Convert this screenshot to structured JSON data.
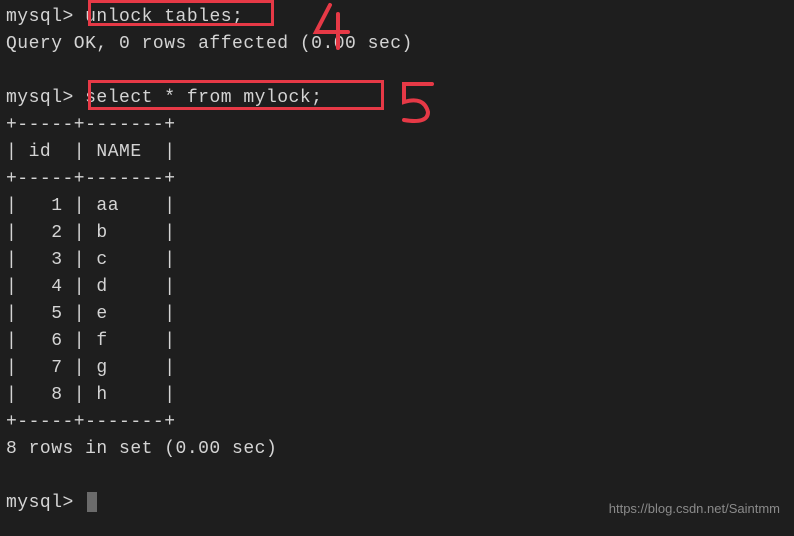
{
  "prompt": "mysql>",
  "cmd1": "unlock tables;",
  "resp1": "Query OK, 0 rows affected (0.00 sec)",
  "cmd2": "select * from mylock;",
  "table": {
    "border_top": "+-----+-------+",
    "header": "| id  | NAME  |",
    "border_mid": "+-----+-------+",
    "rows": [
      "|   1 | aa    |",
      "|   2 | b     |",
      "|   3 | c     |",
      "|   4 | d     |",
      "|   5 | e     |",
      "|   6 | f     |",
      "|   7 | g     |",
      "|   8 | h     |"
    ],
    "border_bot": "+-----+-------+"
  },
  "resp2": "8 rows in set (0.00 sec)",
  "annotations": {
    "label4": "4",
    "label5": "5"
  },
  "watermark": "https://blog.csdn.net/Saintmm",
  "chart_data": {
    "type": "table",
    "title": "mylock",
    "columns": [
      "id",
      "NAME"
    ],
    "rows": [
      [
        1,
        "aa"
      ],
      [
        2,
        "b"
      ],
      [
        3,
        "c"
      ],
      [
        4,
        "d"
      ],
      [
        5,
        "e"
      ],
      [
        6,
        "f"
      ],
      [
        7,
        "g"
      ],
      [
        8,
        "h"
      ]
    ]
  }
}
